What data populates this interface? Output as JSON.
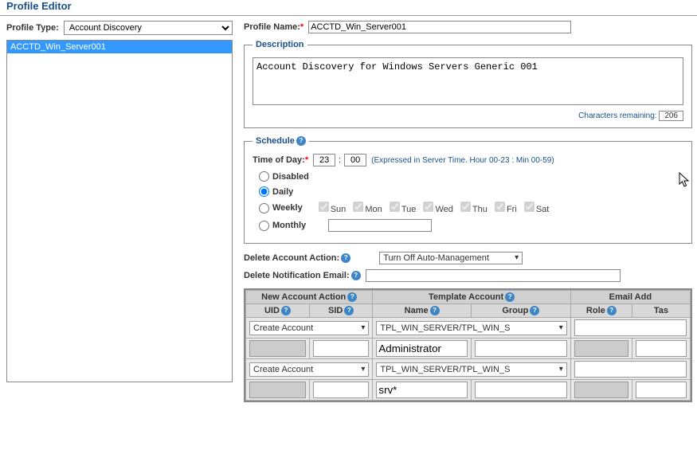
{
  "page_title": "Profile Editor",
  "left": {
    "profile_type_label": "Profile Type:",
    "profile_type_value": "Account Discovery",
    "profiles": [
      "ACCTD_Win_Server001"
    ],
    "selected": "ACCTD_Win_Server001"
  },
  "form": {
    "profile_name_label": "Profile Name:",
    "profile_name_value": "ACCTD_Win_Server001",
    "description_legend": "Description",
    "description_value": "Account Discovery for Windows Servers Generic 001",
    "chars_remaining_label": "Characters remaining:",
    "chars_remaining_value": "206",
    "schedule_legend": "Schedule",
    "time_of_day_label": "Time of Day:",
    "hour": "23",
    "minute": "00",
    "time_hint": "(Expressed in Server Time. Hour 00-23 : Min 00-59)",
    "radios": {
      "disabled": "Disabled",
      "daily": "Daily",
      "weekly": "Weekly",
      "monthly": "Monthly"
    },
    "weekdays": [
      "Sun",
      "Mon",
      "Tue",
      "Wed",
      "Thu",
      "Fri",
      "Sat"
    ],
    "delete_action_label": "Delete Account Action:",
    "delete_action_value": "Turn Off Auto-Management",
    "delete_email_label": "Delete Notification Email:",
    "delete_email_value": ""
  },
  "table": {
    "headers1": {
      "new_account": "New Account Action",
      "template": "Template Account",
      "email": "Email Add"
    },
    "headers2": {
      "uid": "UID",
      "sid": "SID",
      "name": "Name",
      "group": "Group",
      "role": "Role",
      "task": "Tas"
    },
    "rows": [
      {
        "action": "Create Account",
        "template": "TPL_WIN_SERVER/TPL_WIN_S",
        "email": "",
        "uid": "",
        "sid": "",
        "name": "Administrator",
        "group": "",
        "role": "",
        "task": ""
      },
      {
        "action": "Create Account",
        "template": "TPL_WIN_SERVER/TPL_WIN_S",
        "email": "",
        "uid": "",
        "sid": "",
        "name": "srv*",
        "group": "",
        "role": "",
        "task": ""
      }
    ]
  }
}
